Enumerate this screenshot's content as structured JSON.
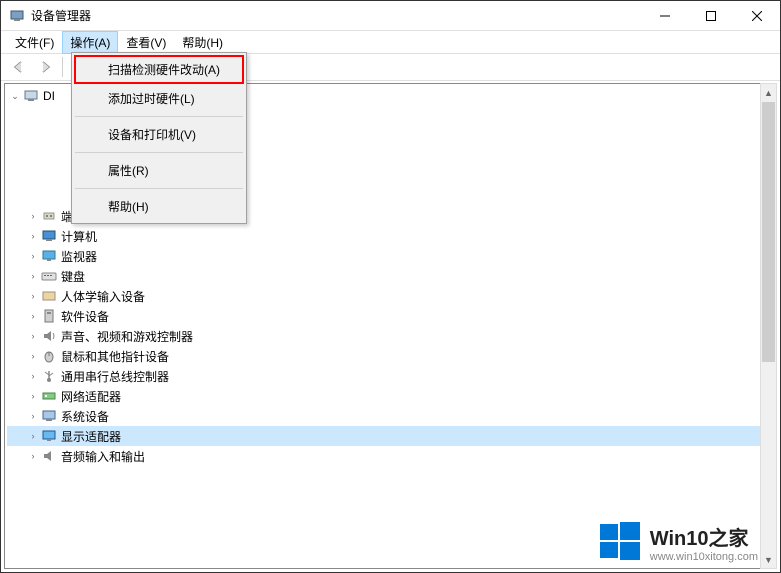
{
  "window": {
    "title": "设备管理器"
  },
  "menu": {
    "items": [
      {
        "label": "文件(F)"
      },
      {
        "label": "操作(A)"
      },
      {
        "label": "查看(V)"
      },
      {
        "label": "帮助(H)"
      }
    ]
  },
  "dropdown": {
    "items": [
      {
        "label": "扫描检测硬件改动(A)"
      },
      {
        "label": "添加过时硬件(L)"
      },
      {
        "label": "设备和打印机(V)"
      },
      {
        "label": "属性(R)"
      },
      {
        "label": "帮助(H)"
      }
    ]
  },
  "tree": {
    "root": "DI",
    "items": [
      {
        "label": "端口 (COM 和 LPT)",
        "icon": "port"
      },
      {
        "label": "计算机",
        "icon": "computer"
      },
      {
        "label": "监视器",
        "icon": "monitor"
      },
      {
        "label": "键盘",
        "icon": "keyboard"
      },
      {
        "label": "人体学输入设备",
        "icon": "hid"
      },
      {
        "label": "软件设备",
        "icon": "software"
      },
      {
        "label": "声音、视频和游戏控制器",
        "icon": "audio"
      },
      {
        "label": "鼠标和其他指针设备",
        "icon": "mouse"
      },
      {
        "label": "通用串行总线控制器",
        "icon": "usb"
      },
      {
        "label": "网络适配器",
        "icon": "network"
      },
      {
        "label": "系统设备",
        "icon": "system"
      },
      {
        "label": "显示适配器",
        "icon": "display",
        "selected": true
      },
      {
        "label": "音频输入和输出",
        "icon": "audioio"
      }
    ]
  },
  "watermark": {
    "title": "Win10之家",
    "url": "www.win10xitong.com"
  }
}
